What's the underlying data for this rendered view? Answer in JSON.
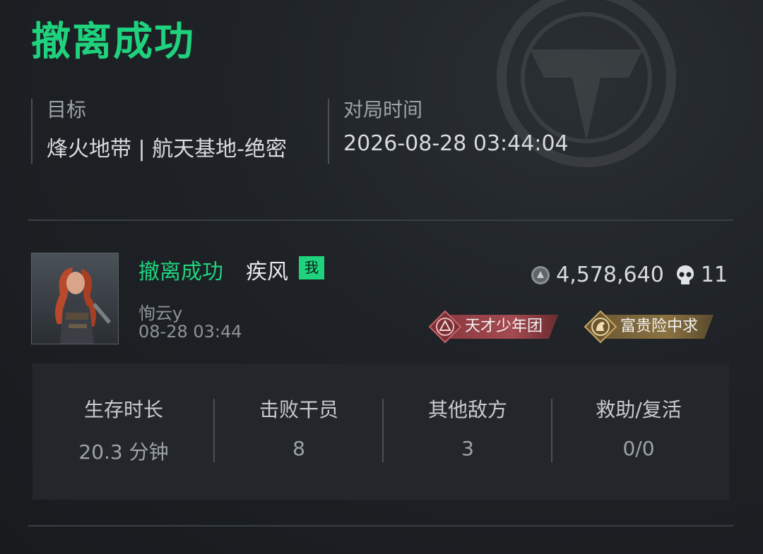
{
  "header": {
    "title": "撤离成功"
  },
  "meta": {
    "target_label": "目标",
    "target_value": "烽火地带 | 航天基地-绝密",
    "time_label": "对局时间",
    "time_value": "2026-08-28 03:44:04"
  },
  "player": {
    "status": "撤离成功",
    "name": "疾风",
    "me_tag": "我",
    "id": "恂云y",
    "time": "08-28 03:44",
    "value": "4,578,640",
    "kills": "11",
    "badges": [
      {
        "label": "天才少年团",
        "icon": "triangle-emblem-icon"
      },
      {
        "label": "富贵险中求",
        "icon": "horse-emblem-icon"
      }
    ]
  },
  "stats": [
    {
      "label": "生存时长",
      "value": "20.3 分钟"
    },
    {
      "label": "击败干员",
      "value": "8"
    },
    {
      "label": "其他敌方",
      "value": "3"
    },
    {
      "label": "救助/复活",
      "value": "0/0"
    }
  ],
  "colors": {
    "accent": "#1fd27d",
    "background": "#1e2226",
    "panel": "#23272b"
  }
}
